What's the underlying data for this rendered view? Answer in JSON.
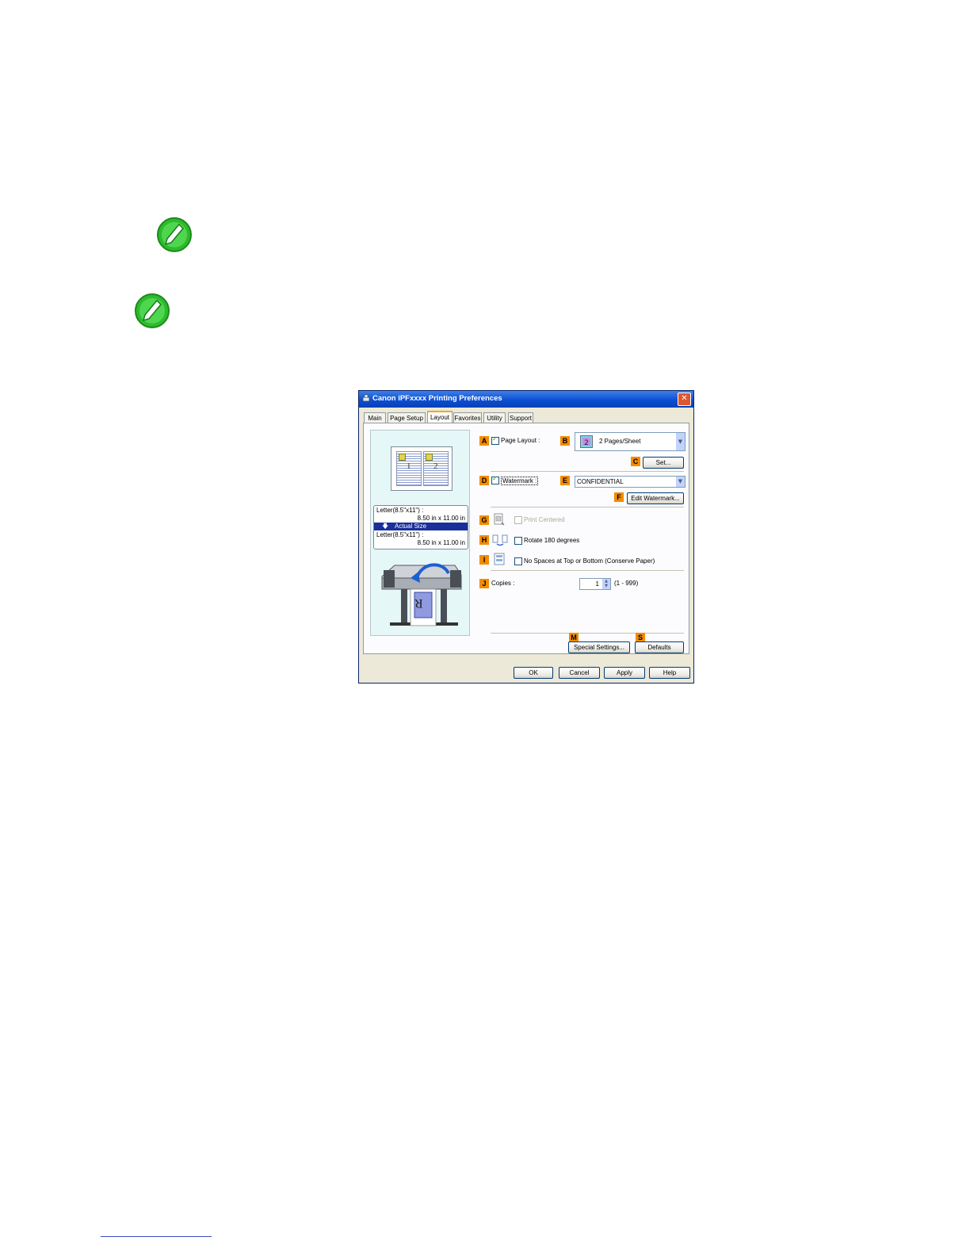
{
  "note_icons": [
    "note-pencil-icon",
    "note-pencil-icon"
  ],
  "dialog": {
    "title": "Canon iPFxxxx Printing Preferences",
    "close": "✕",
    "tabs": [
      "Main",
      "Page Setup",
      "Layout",
      "Favorites",
      "Utility",
      "Support"
    ],
    "active_tab": "Layout",
    "preview": {
      "size_in_label": "Letter(8.5\"x11\") :",
      "size_in_dims": "8.50 in x 11.00 in",
      "actual_size": "Actual Size",
      "size_out_label": "Letter(8.5\"x11\") :",
      "size_out_dims": "8.50 in x 11.00 in",
      "printer_letter": "R"
    },
    "badges": {
      "A": "A",
      "B": "B",
      "C": "C",
      "D": "D",
      "E": "E",
      "F": "F",
      "G": "G",
      "H": "H",
      "I": "I",
      "J": "J",
      "M": "M",
      "S": "S"
    },
    "page_layout": {
      "label": "Page Layout :",
      "checked": true,
      "value": "2 Pages/Sheet"
    },
    "set_button": "Set...",
    "watermark": {
      "label": "Watermark :",
      "checked": true,
      "value": "CONFIDENTIAL"
    },
    "edit_watermark_button": "Edit Watermark...",
    "print_centered": {
      "label": "Print Centered",
      "checked": false,
      "disabled": true
    },
    "rotate": {
      "label": "Rotate 180 degrees",
      "checked": false
    },
    "no_spaces": {
      "label": "No Spaces at Top or Bottom (Conserve Paper)",
      "checked": false
    },
    "copies": {
      "label": "Copies :",
      "value": "1",
      "range": "(1 - 999)"
    },
    "special_settings_button": "Special Settings...",
    "defaults_button": "Defaults",
    "ok_button": "OK",
    "cancel_button": "Cancel",
    "apply_button": "Apply",
    "help_button": "Help"
  }
}
